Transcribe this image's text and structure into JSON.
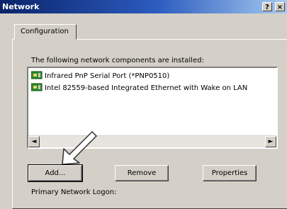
{
  "window": {
    "title": "Network",
    "help_btn": "?",
    "close_btn": "×"
  },
  "tabs": [
    "Configuration"
  ],
  "caption": "The following network components are installed:",
  "components": [
    {
      "label": "Infrared PnP Serial Port (*PNP0510)",
      "icon": "network-card-icon"
    },
    {
      "label": "Intel 82559-based Integrated Ethernet with Wake on LAN",
      "icon": "network-card-icon"
    }
  ],
  "scroll": {
    "left": "◄",
    "right": "►"
  },
  "buttons": {
    "add": "Add...",
    "remove": "Remove",
    "properties": "Properties"
  },
  "partial_label": "Primary Network Logon:",
  "colors": {
    "titlebar_start": "#0a246a",
    "titlebar_end": "#a6caf0",
    "pointer_arrow": "#ffffff"
  }
}
